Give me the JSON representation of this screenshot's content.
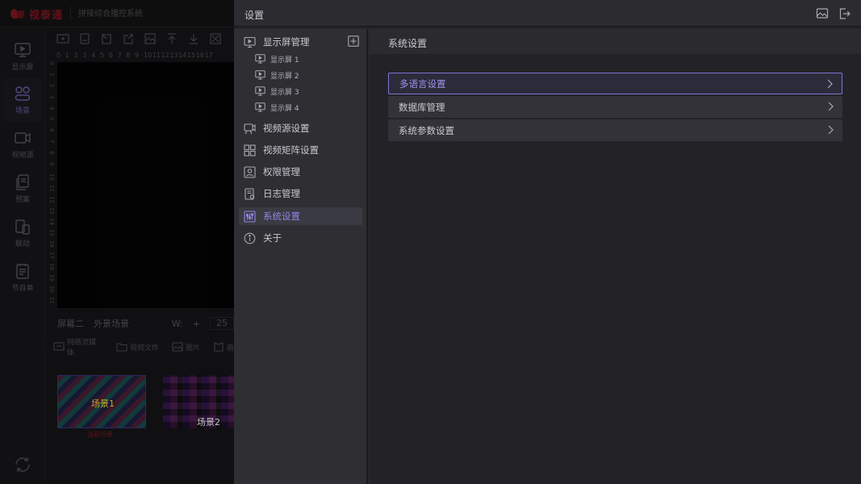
{
  "background_app": {
    "logo_text": "视泰通",
    "logo_sub": "拼接综合播控系统",
    "nav": [
      {
        "label": "显示屏",
        "icon": "display-icon"
      },
      {
        "label": "场景",
        "icon": "scene-icon"
      },
      {
        "label": "视频源",
        "icon": "video-camera-icon"
      },
      {
        "label": "预案",
        "icon": "plan-icon"
      },
      {
        "label": "联动",
        "icon": "linkage-icon"
      },
      {
        "label": "节目单",
        "icon": "program-list-icon"
      }
    ],
    "ruler_x": [
      "0",
      "1",
      "2",
      "3",
      "4",
      "5",
      "6",
      "7",
      "8",
      "9",
      "10",
      "11",
      "12",
      "13",
      "14",
      "15",
      "16",
      "17"
    ],
    "ruler_y": [
      "0",
      "1",
      "2",
      "3",
      "4",
      "5",
      "6",
      "7",
      "8",
      "9",
      "10",
      "11",
      "12",
      "13",
      "14",
      "15",
      "16",
      "17",
      "18",
      "19",
      "20",
      "21"
    ],
    "canvas_footer": {
      "screen": "屏幕二",
      "scene": "外景场景",
      "w_label": "W:",
      "plus": "+",
      "value": "25"
    },
    "media_tabs": [
      "网络流媒体",
      "视频文件",
      "图片",
      "画"
    ],
    "thumbnails": [
      {
        "label": "场景1",
        "sub": "当前场景"
      },
      {
        "label": "场景2"
      }
    ]
  },
  "panel": {
    "title": "设置",
    "header_icons": [
      "screenshot-icon",
      "logout-icon"
    ],
    "tree": {
      "display_management": "显示屏管理",
      "screens": [
        "显示屏 1",
        "显示屏 2",
        "显示屏 3",
        "显示屏 4"
      ],
      "items": [
        {
          "label": "视频源设置",
          "icon": "video-source-icon"
        },
        {
          "label": "视频矩阵设置",
          "icon": "matrix-icon"
        },
        {
          "label": "权限管理",
          "icon": "permission-icon"
        },
        {
          "label": "日志管理",
          "icon": "log-icon"
        },
        {
          "label": "系统设置",
          "icon": "system-settings-icon",
          "active": true
        },
        {
          "label": "关于",
          "icon": "info-icon"
        }
      ]
    },
    "content": {
      "title": "系统设置",
      "rows": [
        {
          "label": "多语言设置",
          "active": true
        },
        {
          "label": "数据库管理",
          "active": false
        },
        {
          "label": "系统参数设置",
          "active": false
        }
      ]
    }
  },
  "colors": {
    "accent": "#8f86e6",
    "brand": "#b3202a",
    "panel_bg": "#26262b"
  }
}
